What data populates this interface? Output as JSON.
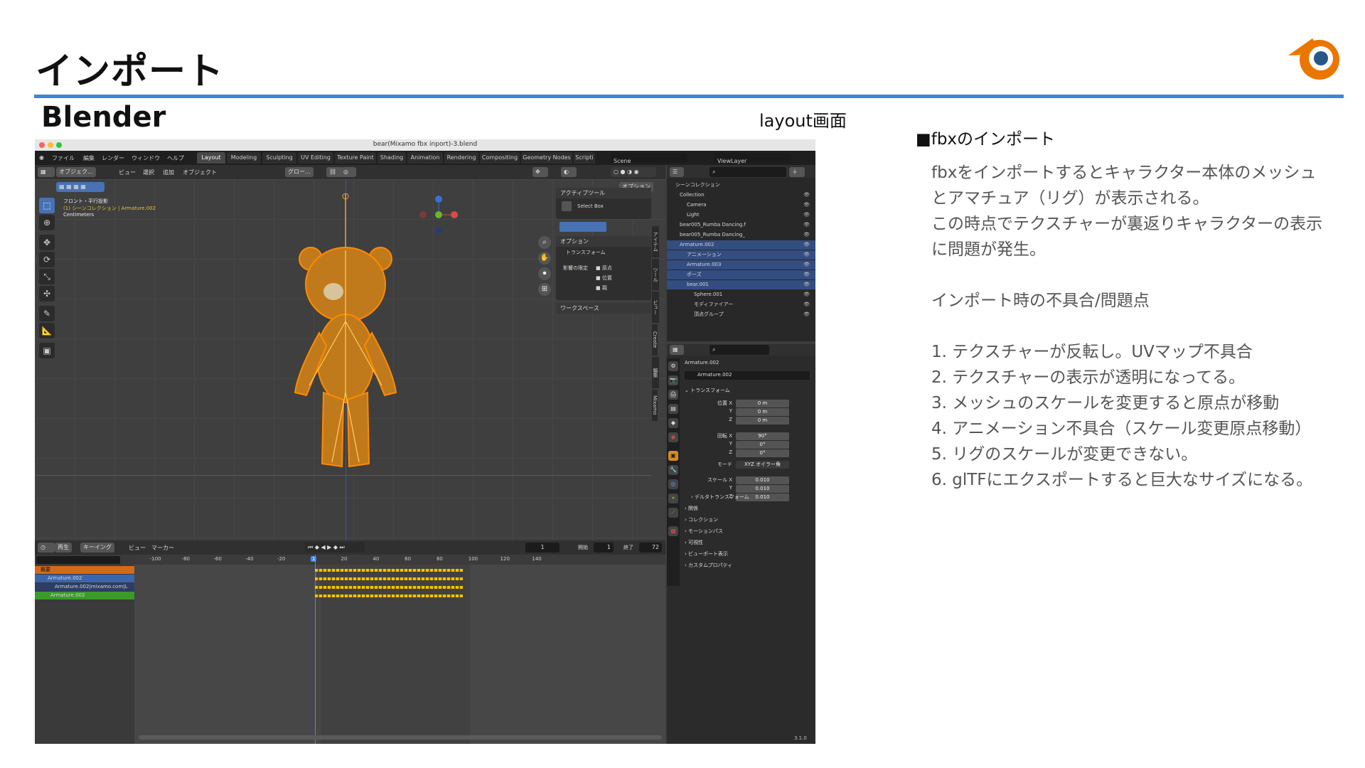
{
  "slide": {
    "title": "インポート",
    "subtitle": "Blender",
    "caption": "layout画面"
  },
  "notes": {
    "heading": "■fbxのインポート",
    "intro": [
      "fbxをインポートするとキャラクター本体のメッシュ",
      "とアマチュア（リグ）が表示される。",
      "この時点でテクスチャーが裏返りキャラクターの表示",
      "に問題が発生。"
    ],
    "issues_heading": "インポート時の不具合/問題点",
    "issues": [
      "1. テクスチャーが反転し。UVマップ不具合",
      "2. テクスチャーの表示が透明になってる。",
      "3. メッシュのスケールを変更すると原点が移動",
      "4. アニメーション不具合（スケール変更原点移動）",
      "5. リグのスケールが変更できない。",
      "6. glTFにエクスポートすると巨大なサイズになる。"
    ]
  },
  "blender": {
    "window_title": "bear(Mixamo fbx inport)-3.blend",
    "menu": [
      "ファイル",
      "編集",
      "レンダー",
      "ウィンドウ",
      "ヘルプ"
    ],
    "workspaces": [
      "Layout",
      "Modeling",
      "Sculpting",
      "UV Editing",
      "Texture Paint",
      "Shading",
      "Animation",
      "Rendering",
      "Compositing",
      "Geometry Nodes",
      "Scripti"
    ],
    "scene": "Scene",
    "view_layer": "ViewLayer",
    "viewport_header": {
      "mode": "オブジェク...",
      "menus": [
        "ビュー",
        "選択",
        "追加",
        "オブジェクト"
      ],
      "orientation": "グロー...",
      "options": "オプション"
    },
    "viewport_info": [
      "フロント・平行投影",
      "(1) シーンコレクション | Armature.002",
      "Centimeters"
    ],
    "active_tool": {
      "header": "アクティブツール",
      "tool": "Select Box",
      "options_header": "オプション",
      "transform": "トランスフォーム",
      "affect_only": "影響の限定",
      "checks": [
        "原点",
        "位置",
        "親"
      ],
      "workspace": "ワークスペース"
    },
    "side_tabs": [
      "アイテム",
      "ツール",
      "ビュー",
      "Create",
      "編集",
      "Mixamo"
    ],
    "outliner": {
      "root": "シーンコレクション",
      "rows": [
        {
          "name": "Collection",
          "sel": false,
          "indent": 1
        },
        {
          "name": "Camera",
          "sel": false,
          "indent": 2
        },
        {
          "name": "Light",
          "sel": false,
          "indent": 2
        },
        {
          "name": "bear005_Rumba Dancing.f",
          "sel": false,
          "indent": 1
        },
        {
          "name": "bear005_Rumba Dancing_",
          "sel": false,
          "indent": 1
        },
        {
          "name": "Armature.002",
          "sel": true,
          "indent": 1
        },
        {
          "name": "アニメーション",
          "sel": true,
          "indent": 2
        },
        {
          "name": "Armature.003",
          "sel": true,
          "indent": 2
        },
        {
          "name": "ポーズ",
          "sel": true,
          "indent": 2
        },
        {
          "name": "bear.001",
          "sel": true,
          "indent": 2
        },
        {
          "name": "Sphere.001",
          "sel": false,
          "indent": 3
        },
        {
          "name": "モディファイアー",
          "sel": false,
          "indent": 3
        },
        {
          "name": "頂点グループ",
          "sel": false,
          "indent": 3
        }
      ]
    },
    "properties": {
      "object": "Armature.002",
      "data": "Armature.002",
      "transform": "トランスフォーム",
      "location_label": "位置 X",
      "location": [
        "0 m",
        "0 m",
        "0 m"
      ],
      "rotation_label": "回転 X",
      "rotation": [
        "90°",
        "0°",
        "0°"
      ],
      "mode_label": "モード",
      "mode": "XYZ オイラー角",
      "scale_label": "スケール X",
      "scale": [
        "0.010",
        "0.010",
        "0.010"
      ],
      "delta": "デルタトランスフォーム",
      "sections": [
        "関係",
        "コレクション",
        "モーションパス",
        "可視性",
        "ビューポート表示",
        "カスタムプロパティ"
      ]
    },
    "timeline": {
      "menus": [
        "再生",
        "キーイング",
        "ビュー",
        "マーカー"
      ],
      "current_frame": "1",
      "start_label": "開始",
      "start": "1",
      "end_label": "終了",
      "end": "72",
      "ruler": [
        "-100",
        "-80",
        "-60",
        "-40",
        "-20",
        "1",
        "20",
        "40",
        "60",
        "80",
        "100",
        "120",
        "140"
      ],
      "channels": [
        "概要",
        "Armature.002",
        "Armature.002|mixamo.com|L",
        "Armature.002"
      ],
      "version": "3.1.0"
    }
  }
}
